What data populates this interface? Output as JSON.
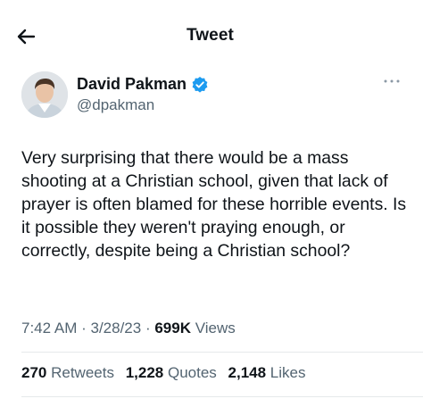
{
  "header": {
    "title": "Tweet",
    "back_icon": "arrow-left-icon"
  },
  "author": {
    "name": "David Pakman",
    "handle": "@dpakman",
    "verified_icon": "verified-badge-icon",
    "verified_color": "#1d9bf0"
  },
  "more_icon": "more-horizontal-icon",
  "tweet": {
    "text": "Very surprising that there would be a mass shooting at a Christian school, given that lack of prayer is often blamed for these horrible events. Is it possible they weren't praying enough, or correctly, despite being a Christian school?"
  },
  "meta": {
    "time": "7:42 AM",
    "sep1": " · ",
    "date": "3/28/23",
    "sep2": " · ",
    "views_count": "699K",
    "views_label": " Views"
  },
  "stats": {
    "retweets_count": "270",
    "retweets_label": " Retweets",
    "quotes_count": "1,228",
    "quotes_label": " Quotes",
    "likes_count": "2,148",
    "likes_label": " Likes"
  },
  "colors": {
    "text": "#0f1419",
    "secondary": "#536471",
    "divider": "#e6e9eb",
    "background": "#ffffff"
  }
}
